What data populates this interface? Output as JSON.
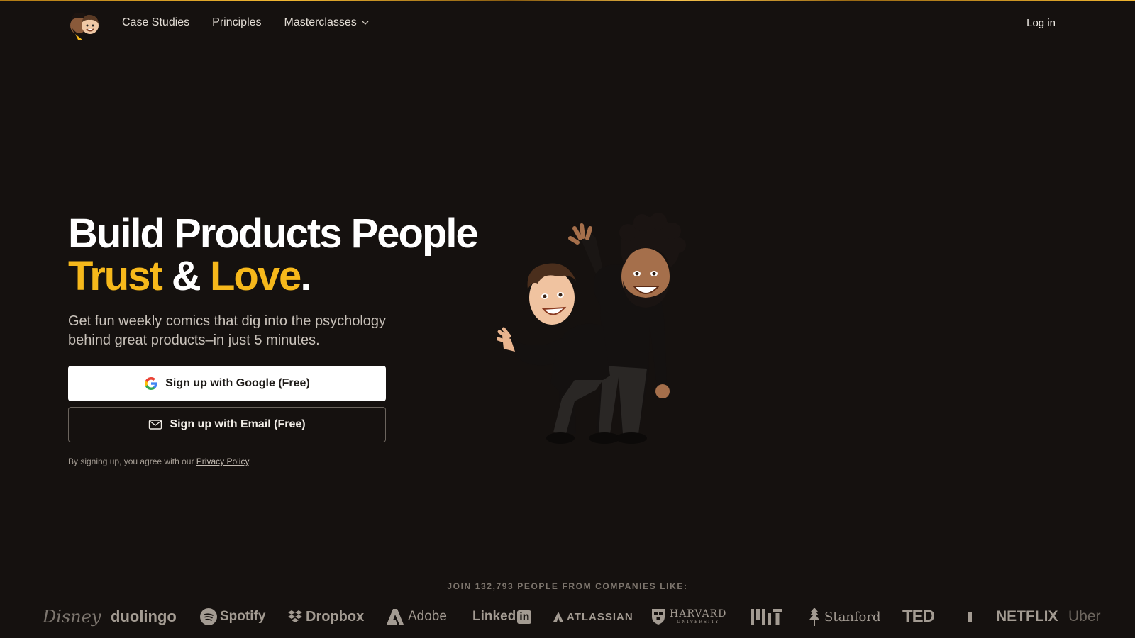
{
  "header": {
    "logo_icon": "two-avatar-faces-logo",
    "nav": [
      {
        "label": "Case Studies"
      },
      {
        "label": "Principles"
      },
      {
        "label": "Masterclasses",
        "icon": "chevron-down-icon"
      }
    ],
    "login_label": "Log in"
  },
  "hero": {
    "title_line1": "Build Products People",
    "title_word_trust": "Trust",
    "title_amp": " & ",
    "title_word_love": "Love",
    "title_dot": ".",
    "subtitle": "Get fun weekly comics that dig into the psychology behind great products–in just 5 minutes.",
    "google_button_label": "Sign up with Google (Free)",
    "email_button_label": "Sign up with Email (Free)",
    "terms_prefix": "By signing up, you agree with our ",
    "terms_link": "Privacy Policy",
    "terms_suffix": "."
  },
  "companies": {
    "heading": "JOIN 132,793 PEOPLE FROM COMPANIES LIKE:",
    "logos": [
      "Disney",
      "duolingo",
      "Spotify",
      "Dropbox",
      "Adobe",
      "Linked",
      "in",
      "ATLASSIAN",
      "HARVARD",
      "UNIVERSITY",
      "MIT",
      "Stanford",
      "TED",
      "NETFLIX",
      "Uber"
    ]
  },
  "colors": {
    "background": "#15110f",
    "accent_gold": "#f6b81b",
    "text": "#ffffff"
  }
}
